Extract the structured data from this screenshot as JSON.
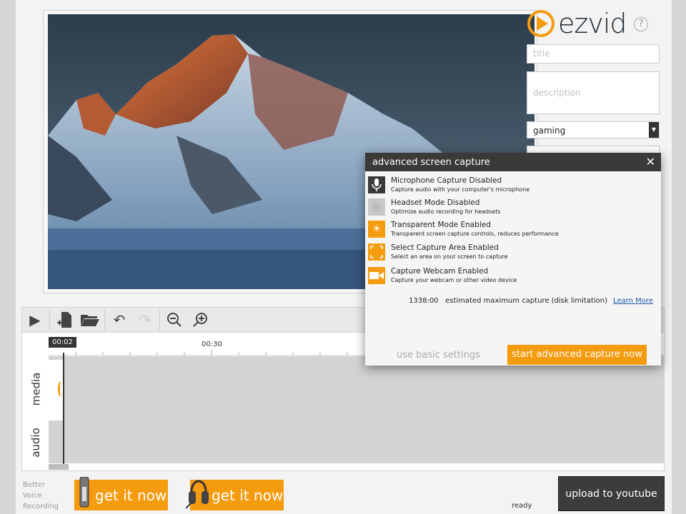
{
  "brand": {
    "name": "ezvid",
    "accent": "#f59b0e"
  },
  "meta": {
    "title_placeholder": "title",
    "description_placeholder": "description",
    "category": "gaming",
    "help": "?"
  },
  "timeline": {
    "playhead": "00:02",
    "ruler_label": "00:30",
    "tracks": [
      "media",
      "audio"
    ]
  },
  "promo": {
    "better_lines": [
      "Better",
      "Voice",
      "Recording"
    ],
    "mic_button": "get it now",
    "headset_button": "get it now"
  },
  "status": "ready",
  "upload_button": "upload to youtube",
  "dialog": {
    "title": "advanced screen capture",
    "close": "✕",
    "options": [
      {
        "title": "Microphone Capture Disabled",
        "desc": "Capture audio with your computer's microphone",
        "icon": "microphone-icon",
        "enabled": false
      },
      {
        "title": "Headset Mode Disabled",
        "desc": "Optimize audio recording for headsets",
        "icon": "headset-icon",
        "enabled": false
      },
      {
        "title": "Transparent Mode Enabled",
        "desc": "Transparent screen capture controls, reduces performance",
        "icon": "transparency-icon",
        "enabled": true
      },
      {
        "title": "Select Capture Area Enabled",
        "desc": "Select an area on your screen to capture",
        "icon": "capture-area-icon",
        "enabled": true
      },
      {
        "title": "Capture Webcam Enabled",
        "desc": "Capture your webcam or other video device",
        "icon": "webcam-icon",
        "enabled": true
      }
    ],
    "estimate_value": "1338:00",
    "estimate_text": "estimated maximum capture (disk limitation)",
    "learn_more": "Learn More",
    "basic_button": "use basic settings",
    "start_button": "start advanced capture now"
  }
}
